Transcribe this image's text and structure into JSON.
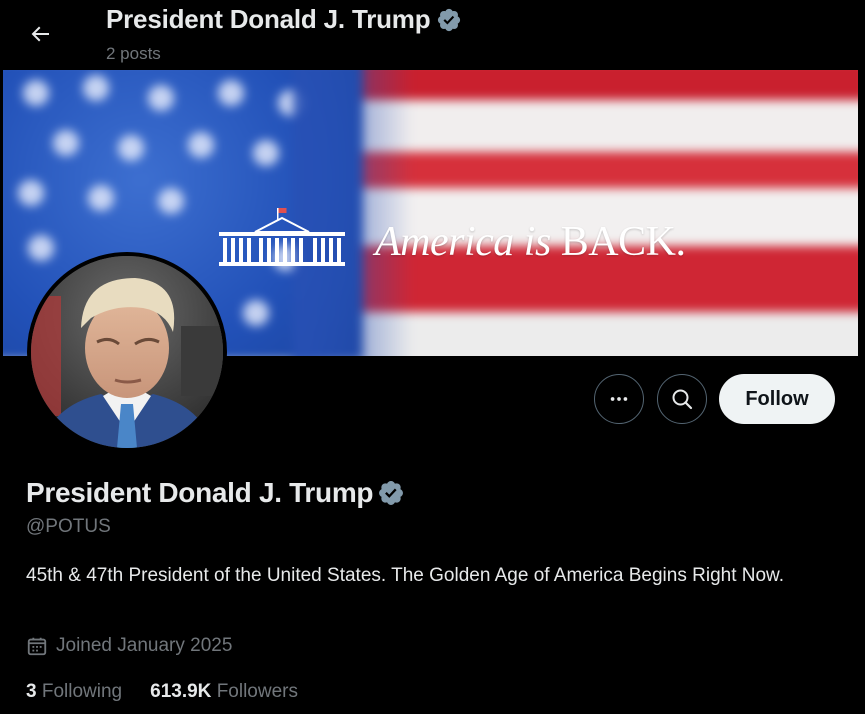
{
  "header": {
    "title": "President Donald J. Trump",
    "post_count": "2 posts"
  },
  "banner": {
    "text_italic": "America is",
    "text_caps": "BACK."
  },
  "actions": {
    "follow_label": "Follow"
  },
  "profile": {
    "name": "President Donald J. Trump",
    "handle": "@POTUS",
    "bio": "45th & 47th President of the United States. The Golden Age of America Begins Right Now.",
    "joined": "Joined January 2025",
    "following_count": "3",
    "following_label": "Following",
    "followers_count": "613.9K",
    "followers_label": "Followers"
  },
  "icons": {
    "back": "arrow-left-icon",
    "verified": "verified-badge-icon",
    "more": "more-icon",
    "search": "search-icon",
    "calendar": "calendar-icon"
  },
  "colors": {
    "background": "#000000",
    "text_primary": "#e7e9ea",
    "text_secondary": "#71767b",
    "verified_badge": "#829aab",
    "follow_bg": "#eff3f4",
    "border": "#536471"
  }
}
